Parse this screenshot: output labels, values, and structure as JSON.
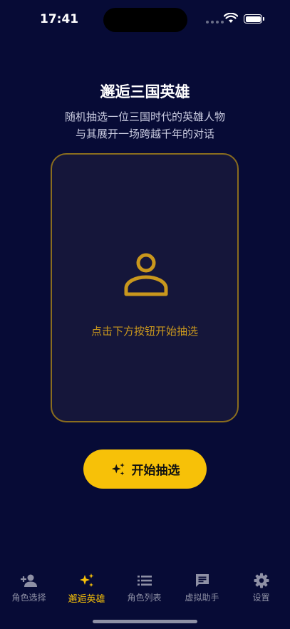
{
  "status_bar": {
    "time": "17:41"
  },
  "header": {
    "title": "邂逅三国英雄",
    "subtitle_line1": "随机抽选一位三国时代的英雄人物",
    "subtitle_line2": "与其展开一场跨越千年的对话"
  },
  "card": {
    "icon": "person-icon",
    "hint": "点击下方按钮开始抽选"
  },
  "actions": {
    "start_label": "开始抽选",
    "start_icon": "sparkles-icon"
  },
  "tabs": [
    {
      "label": "角色选择",
      "icon": "add-person-icon",
      "active": false
    },
    {
      "label": "邂逅英雄",
      "icon": "sparkles-icon",
      "active": true
    },
    {
      "label": "角色列表",
      "icon": "list-icon",
      "active": false
    },
    {
      "label": "虚拟助手",
      "icon": "chat-icon",
      "active": false
    },
    {
      "label": "设置",
      "icon": "gear-icon",
      "active": false
    }
  ],
  "colors": {
    "background": "#070b36",
    "accent": "#f7c108",
    "card_border": "#8a6d1e",
    "inactive": "#8e90a5"
  }
}
